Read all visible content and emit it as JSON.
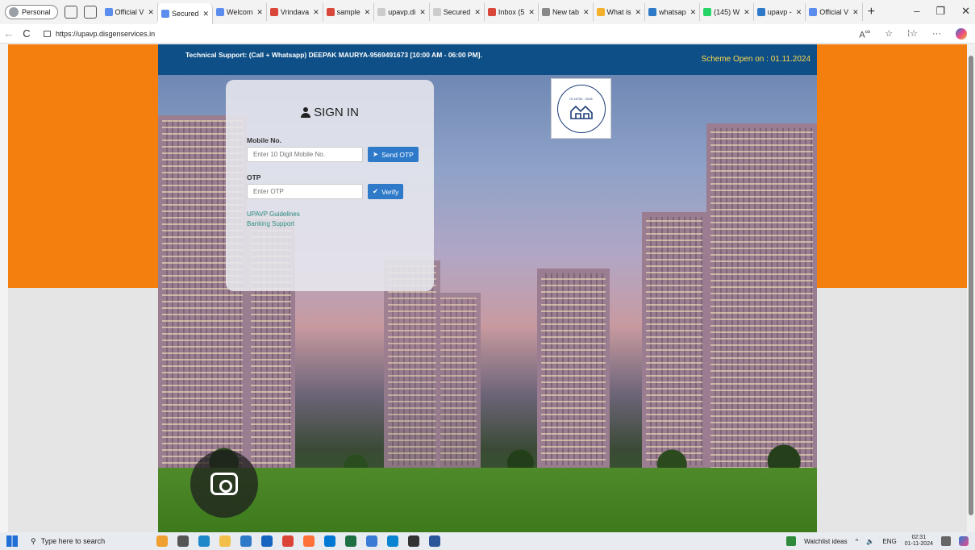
{
  "browser": {
    "profile_label": "Personal",
    "tabs": [
      {
        "label": "Official V"
      },
      {
        "label": "Secured"
      },
      {
        "label": "Welcom"
      },
      {
        "label": "Vrindava"
      },
      {
        "label": "sample"
      },
      {
        "label": "upavp.di"
      },
      {
        "label": "Secured"
      },
      {
        "label": "Inbox (5"
      },
      {
        "label": "New tab"
      },
      {
        "label": "What is"
      },
      {
        "label": "whatsap"
      },
      {
        "label": "(145) W"
      },
      {
        "label": "upavp -"
      },
      {
        "label": "Official V"
      }
    ],
    "tab_close": "✕",
    "new_tab": "+",
    "minimize": "–",
    "restore": "❐",
    "close": "✕",
    "back": "←",
    "refresh": "C",
    "url": "https://upavp.disgenservices.in"
  },
  "site": {
    "support_text": "Technical Support: (Call + Whatsapp) DEEPAK MAURYA-9569491673 [10:00 AM - 06:00 PM].",
    "scheme_text": "Scheme Open on : 01.11.2024",
    "logo_text": "IS 15700 : 2018"
  },
  "signin": {
    "title": "SIGN IN",
    "mobile_label": "Mobile No.",
    "mobile_placeholder": "Enter 10 Digit Mobile No.",
    "send_otp": "Send OTP",
    "otp_label": "OTP",
    "otp_placeholder": "Enter OTP",
    "verify": "Verify",
    "links": [
      "UPAVP Guidelines",
      "Banking Support"
    ]
  },
  "taskbar": {
    "search_placeholder": "Type here to search",
    "watchlist": "Watchlist ideas",
    "lang": "ENG",
    "time": "02:31",
    "date": "01-11-2024"
  },
  "colors": {
    "orange": "#f47f0e",
    "header_blue": "#0d4f86",
    "button_blue": "#2e7ac9",
    "link_teal": "#2b8d82",
    "scheme_yellow": "#ffd84d"
  }
}
